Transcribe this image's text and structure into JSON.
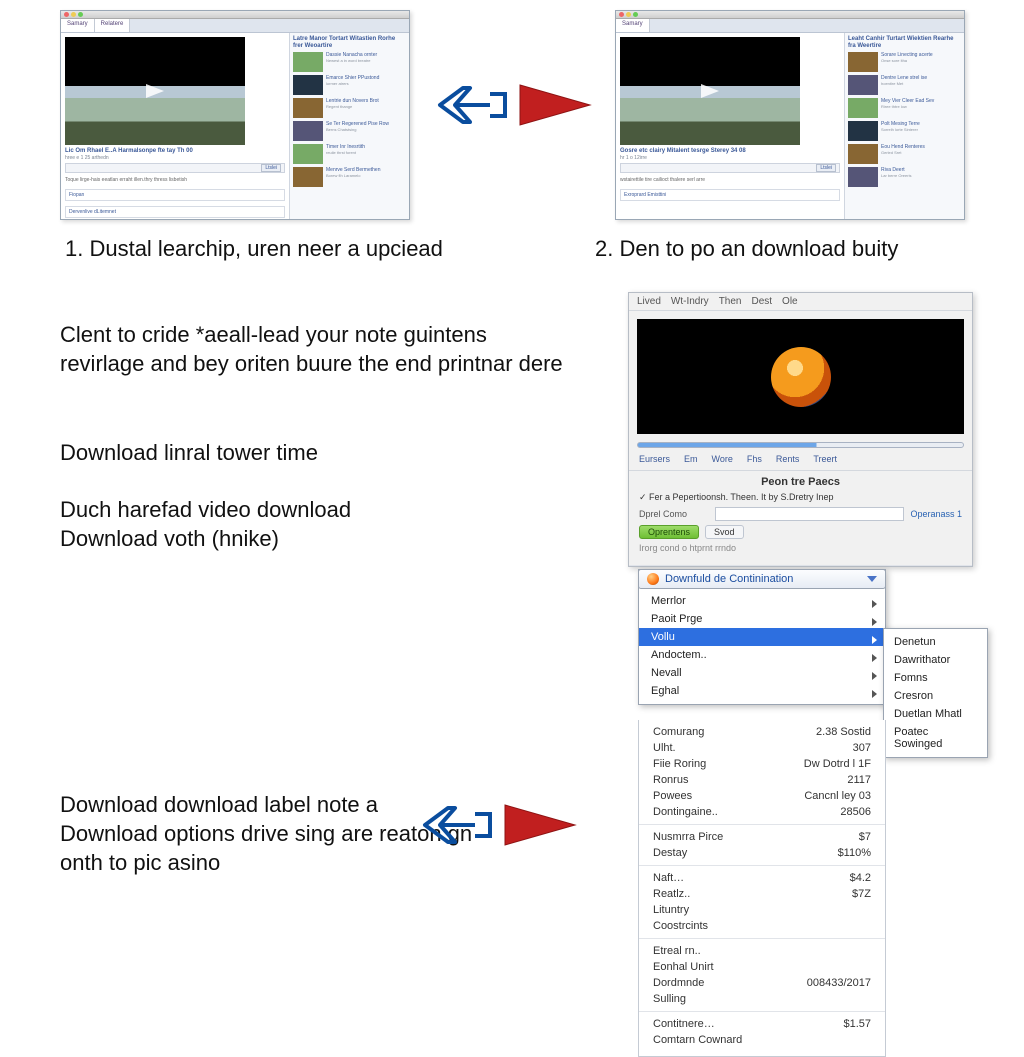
{
  "steps": {
    "s1": "1. Dustal learchip, uren neer a upciead",
    "s2": "2. Den to po an download buity"
  },
  "paragraphs": {
    "p1": "Clent to cride *aeall-lead your note guintens revirlage and bey oriten buure the end printnar dere",
    "p2": "Download linral tower time",
    "p3": "Duch harefad video download\nDownload voth (hnike)",
    "p4": "Download download label note a Download options drive sing are reaton gn onth to pic asino"
  },
  "browser": {
    "tab": "Samary",
    "tab2": "Relatere",
    "video_title": "Lic Om Rhael E..A Harmalsonpe fte tay Th 00",
    "video_title2": "Gosre etc clairy Mitalent tesrge Sterey 34 08",
    "btn": "Ltslei",
    "desc": "Toque lirge-hais eeatlan erraht illen.thry thress lisbetish",
    "boxes": [
      "Fiopan",
      "Dervenlive dLitemnet",
      "Exroprard Emisttini"
    ],
    "side_head": "Latre Manor Tortart Witastien Rorhe frer Weoartire",
    "side_head2": "Leaht Canhir Turtart Wiektien Rearhe fra Weertire",
    "thumbs": [
      {
        "t": "Dassie Nanacha ornter",
        "s": "Newest a in word breatre"
      },
      {
        "t": "Emarce Shier PPustond",
        "s": "lormer atrers"
      },
      {
        "t": "Lentrie dun Novers Brot",
        "s": "Regent thange"
      },
      {
        "t": "Se Ter Regerened Pise Row",
        "s": "Berns Chatstsing"
      },
      {
        "t": "Timer Inr Inesrtith",
        "s": "reuile thrst forent"
      },
      {
        "t": "Menrve Serd Bermethen",
        "s": "Borew flh Laramelo"
      }
    ],
    "thumbs2": [
      {
        "t": "Sorare Linecting acerte",
        "s": "Onse sore ltha"
      },
      {
        "t": "Dentre Lene strel ise",
        "s": "hoentire Met"
      },
      {
        "t": "Mey Vier Cleer Ead Sev",
        "s": "Riree thtre low"
      },
      {
        "t": "Polt Mesing Terre",
        "s": "Sorrelh lorte Sinterer"
      },
      {
        "t": "Eou Hend Renteres",
        "s": "Gerled Sret"
      },
      {
        "t": "Riva Deert",
        "s": "Lar berre Oreeris"
      }
    ]
  },
  "panel": {
    "menus": [
      "Lived",
      "Wt-Indry",
      "Then",
      "Dest",
      "Ole"
    ],
    "tabs": [
      "Eursers",
      "Em",
      "Wore",
      "Fhs",
      "Rents",
      "Treert"
    ],
    "section_title": "Peon tre Paecs",
    "checkbox": "Fer a Pepertioonsh. Theen. It by S.Dretry Inep",
    "field_label": "Dprel Como",
    "download_link": "Operanass 1",
    "green_btn": "Oprentens",
    "gray_btn": "Svod",
    "hint": "Irorg cond o htprnt rrndo"
  },
  "dropdown": {
    "header": "Downfuld de Continination",
    "items": [
      {
        "label": "Merrlor",
        "sub": true
      },
      {
        "label": "Paoit Prge",
        "sub": true
      },
      {
        "label": "Vollu",
        "sub": true,
        "highlight": true
      },
      {
        "label": "Andoctem..",
        "sub": true
      },
      {
        "label": "Nevall",
        "sub": true
      },
      {
        "label": "Eghal",
        "sub": true
      }
    ]
  },
  "submenu": {
    "items": [
      "Denetun",
      "Dawrithator",
      "Fomns",
      "Cresron",
      "Duetlan Mhatl",
      "Poatec Sowinged"
    ]
  },
  "props": [
    {
      "k": "Comurang",
      "v": "2.38 Sostid"
    },
    {
      "k": "Ulht.",
      "v": "307"
    },
    {
      "k": "Fiie Roring",
      "v": "Dw Dotrd l 1F"
    },
    {
      "k": "Ronrus",
      "v": "2117"
    },
    {
      "k": "Powees",
      "v": "Cancnl ley 03"
    },
    {
      "k": "Dontingaine..",
      "v": "28506"
    },
    {
      "k": "Nusmrra Pirce",
      "v": "$7"
    },
    {
      "k": "Destay",
      "v": "$110%"
    },
    {
      "k": "Naft…",
      "v": "$4.2"
    },
    {
      "k": "Reatlz..",
      "v": "$7Z"
    },
    {
      "k": "Lituntry",
      "v": ""
    },
    {
      "k": "Coostrcints",
      "v": ""
    },
    {
      "k": "Etreal rn..",
      "v": ""
    },
    {
      "k": "Eonhal Unirt",
      "v": ""
    },
    {
      "k": "Dordmnde",
      "v": "008433/2017"
    },
    {
      "k": "Sulling",
      "v": ""
    },
    {
      "k": "Contitnere…",
      "v": "$1.57"
    },
    {
      "k": "Comtarn Cownard",
      "v": ""
    }
  ]
}
